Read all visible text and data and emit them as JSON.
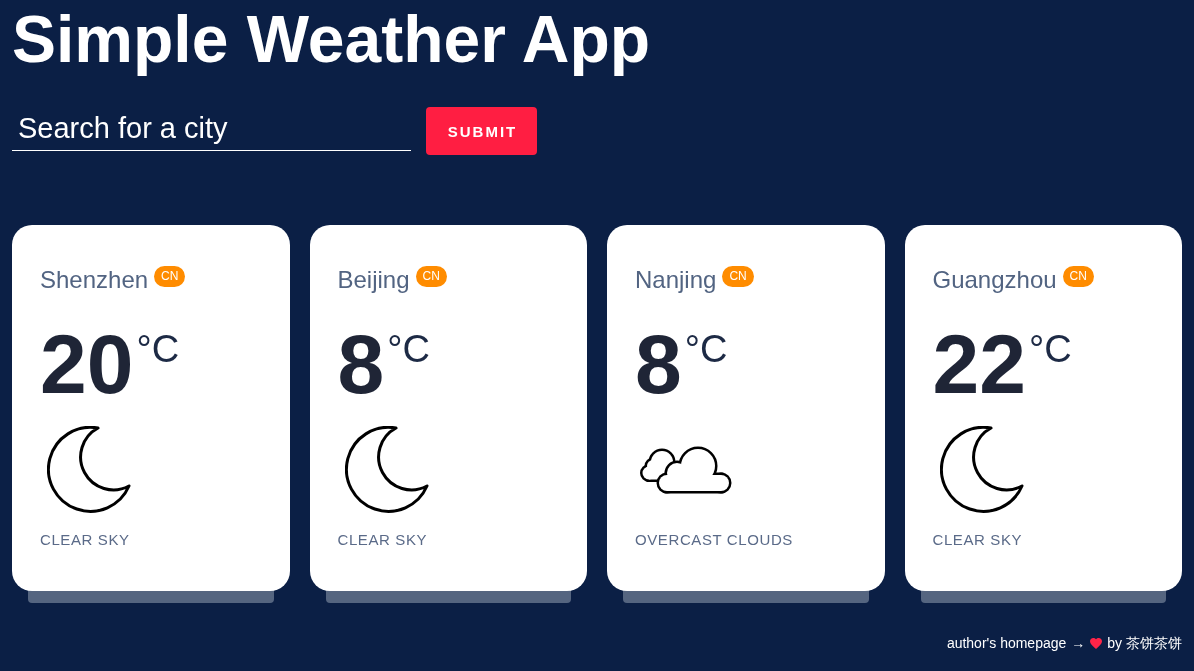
{
  "title": "Simple Weather App",
  "search": {
    "placeholder": "Search for a city",
    "button": "SUBMIT"
  },
  "cards": [
    {
      "city": "Shenzhen",
      "country": "CN",
      "temperature": "20",
      "unit": "°C",
      "kind": "clear",
      "description": "CLEAR SKY"
    },
    {
      "city": "Beijing",
      "country": "CN",
      "temperature": "8",
      "unit": "°C",
      "kind": "clear",
      "description": "CLEAR SKY"
    },
    {
      "city": "Nanjing",
      "country": "CN",
      "temperature": "8",
      "unit": "°C",
      "kind": "clouds",
      "description": "OVERCAST CLOUDS"
    },
    {
      "city": "Guangzhou",
      "country": "CN",
      "temperature": "22",
      "unit": "°C",
      "kind": "clear",
      "description": "CLEAR SKY"
    }
  ],
  "footer": {
    "link": "author's homepage",
    "arrow": "→",
    "byline": "by 茶饼茶饼"
  }
}
